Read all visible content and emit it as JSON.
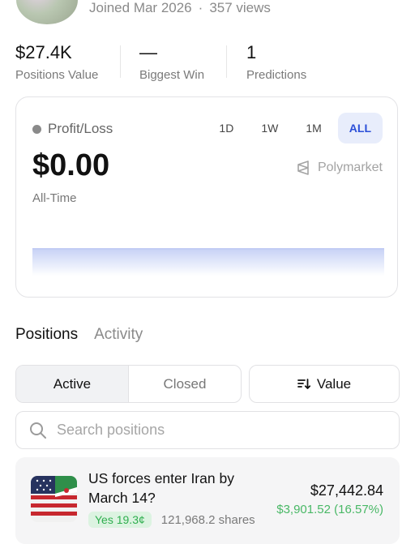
{
  "profile": {
    "joined": "Joined Mar 2026",
    "separator": "·",
    "views": "357 views"
  },
  "stats": [
    {
      "value": "$27.4K",
      "label": "Positions Value"
    },
    {
      "value": "—",
      "label": "Biggest Win"
    },
    {
      "value": "1",
      "label": "Predictions"
    }
  ],
  "pnl": {
    "title": "Profit/Loss",
    "amount": "$0.00",
    "period": "All-Time",
    "brand": "Polymarket",
    "ranges": [
      "1D",
      "1W",
      "1M",
      "ALL"
    ],
    "active_range": "ALL"
  },
  "tabs": {
    "positions": "Positions",
    "activity": "Activity"
  },
  "filter": {
    "active": "Active",
    "closed": "Closed",
    "sort": "Value"
  },
  "search": {
    "placeholder": "Search positions"
  },
  "position": {
    "title": "US forces enter Iran by March 14?",
    "outcome": "Yes 19.3¢",
    "shares": "121,968.2 shares",
    "value": "$27,442.84",
    "pnl": "$3,901.52 (16.57%)"
  },
  "colors": {
    "accent": "#2b4fd8",
    "accent_bg": "#e8edfb",
    "positive": "#49b866",
    "badge_bg": "#dcf3e1"
  }
}
